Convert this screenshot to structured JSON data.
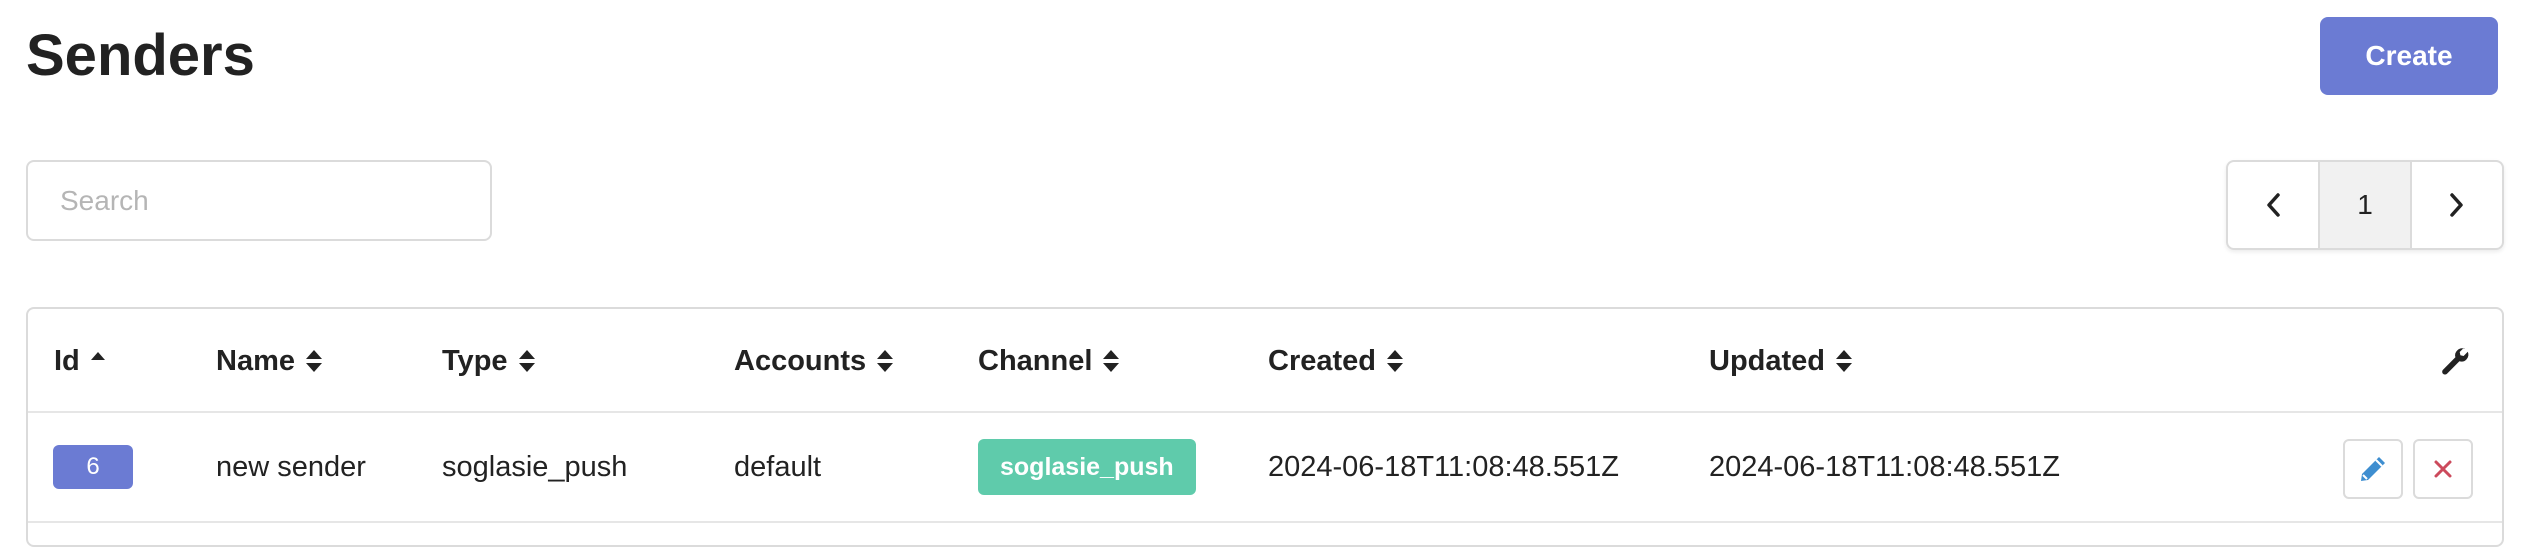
{
  "page": {
    "title": "Senders"
  },
  "toolbar": {
    "create_label": "Create"
  },
  "search": {
    "placeholder": "Search",
    "value": ""
  },
  "pagination": {
    "current_page": "1",
    "prev_icon": "chevron-left-icon",
    "next_icon": "chevron-right-icon"
  },
  "table": {
    "columns": [
      {
        "label": "Id",
        "sort": "asc"
      },
      {
        "label": "Name",
        "sort": "both"
      },
      {
        "label": "Type",
        "sort": "both"
      },
      {
        "label": "Accounts",
        "sort": "both"
      },
      {
        "label": "Channel",
        "sort": "both"
      },
      {
        "label": "Created",
        "sort": "both"
      },
      {
        "label": "Updated",
        "sort": "both"
      }
    ],
    "actions_header_icon": "wrench-icon",
    "rows": [
      {
        "id": "6",
        "name": "new sender",
        "type": "soglasie_push",
        "accounts": "default",
        "channel": "soglasie_push",
        "created": "2024-06-18T11:08:48.551Z",
        "updated": "2024-06-18T11:08:48.551Z",
        "actions": [
          "edit-icon",
          "delete-icon"
        ]
      }
    ]
  },
  "colors": {
    "primary": "#6b7bd3",
    "channel_tag": "#5fcbab",
    "edit_icon": "#3e8ed0",
    "delete_icon": "#cc4a5c"
  }
}
